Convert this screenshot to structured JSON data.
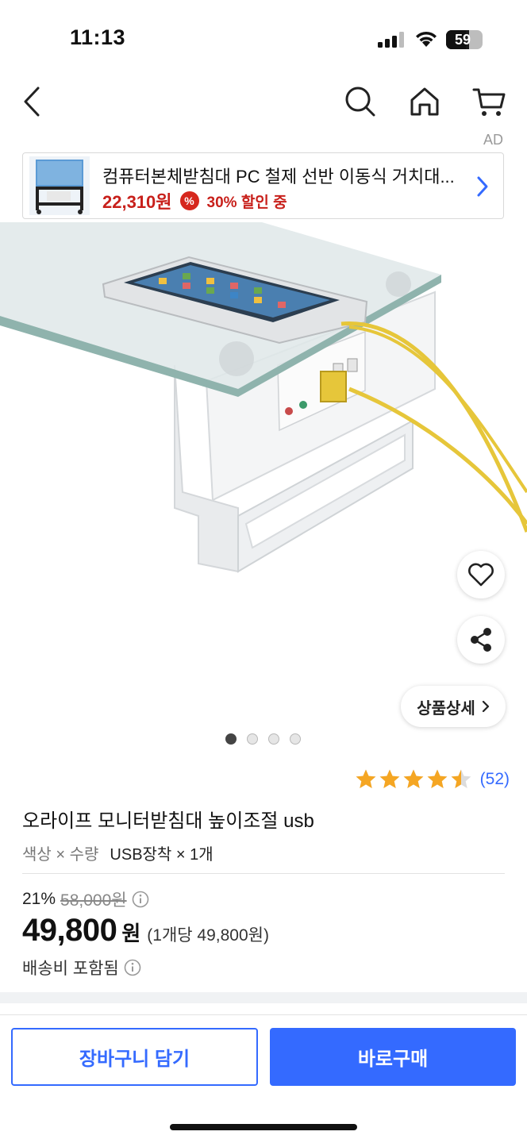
{
  "status_bar": {
    "time": "11:13",
    "battery": "59",
    "battery_level": 0.59
  },
  "nav": {
    "back_icon": "chevron-left-icon",
    "search_icon": "search-icon",
    "home_icon": "home-icon",
    "cart_icon": "cart-icon"
  },
  "ad": {
    "label": "AD",
    "title": "컴퓨터본체받침대 PC 철제 선반 이동식 거치대...",
    "price": "22,310원",
    "badge": "%",
    "discount": "30% 할인 중"
  },
  "product_image": {
    "wishlist_icon": "heart-icon",
    "share_icon": "share-icon",
    "detail_button": "상품상세",
    "page_count": 4,
    "active_page": 1
  },
  "rating": {
    "stars": 4.5,
    "count": "(52)"
  },
  "product": {
    "title": "오라이프 모니터받침대 높이조절 usb",
    "option_label": "색상 × 수량",
    "option_value": "USB장착 × 1개"
  },
  "price": {
    "discount_rate": "21%",
    "original_price": "58,000원",
    "sale_price": "49,800",
    "currency": "원",
    "unit_price": "(1개당 49,800원)",
    "shipping": "배송비 포함됨"
  },
  "buttons": {
    "cart": "장바구니 담기",
    "buy": "바로구매"
  },
  "colors": {
    "accent": "#346aff",
    "ad_red": "#c8201b",
    "star": "#f5a623"
  }
}
